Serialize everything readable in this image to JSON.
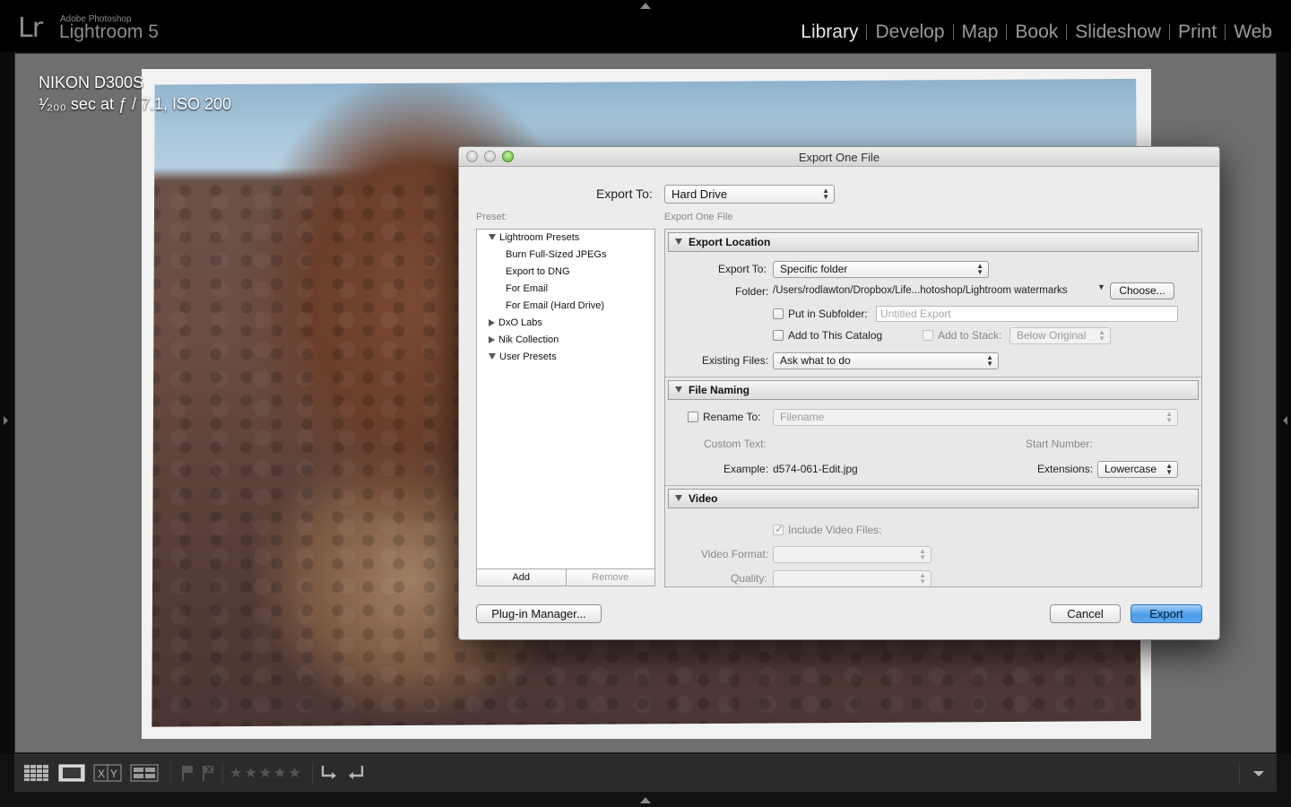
{
  "app": {
    "logo": "Lr",
    "brand_small": "Adobe Photoshop",
    "brand_big": "Lightroom 5"
  },
  "modules": [
    {
      "label": "Library",
      "active": true
    },
    {
      "label": "Develop"
    },
    {
      "label": "Map"
    },
    {
      "label": "Book"
    },
    {
      "label": "Slideshow"
    },
    {
      "label": "Print"
    },
    {
      "label": "Web"
    }
  ],
  "photo_info": {
    "camera": "NIKON D300S",
    "exposure": "¹⁄₂₀₀ sec at ƒ / 7.1, ISO 200"
  },
  "dialog": {
    "title": "Export One File",
    "export_to_label": "Export To:",
    "export_to_value": "Hard Drive",
    "preset_label": "Preset:",
    "settings_label": "Export One File",
    "presets": [
      {
        "label": "Lightroom Presets",
        "type": "folder-open"
      },
      {
        "label": "Burn Full-Sized JPEGs",
        "type": "item"
      },
      {
        "label": "Export to DNG",
        "type": "item"
      },
      {
        "label": "For Email",
        "type": "item"
      },
      {
        "label": "For Email (Hard Drive)",
        "type": "item"
      },
      {
        "label": "DxO Labs",
        "type": "folder-closed"
      },
      {
        "label": "Nik Collection",
        "type": "folder-closed"
      },
      {
        "label": "User Presets",
        "type": "folder-open"
      }
    ],
    "add_label": "Add",
    "remove_label": "Remove",
    "export_location": {
      "title": "Export Location",
      "export_to_label": "Export To:",
      "export_to_value": "Specific folder",
      "folder_label": "Folder:",
      "folder_path": "/Users/rodlawton/Dropbox/Life...hotoshop/Lightroom watermarks",
      "choose_label": "Choose...",
      "subfolder_label": "Put in Subfolder:",
      "subfolder_placeholder": "Untitled Export",
      "add_catalog_label": "Add to This Catalog",
      "add_stack_label": "Add to Stack:",
      "stack_value": "Below Original",
      "existing_files_label": "Existing Files:",
      "existing_files_value": "Ask what to do"
    },
    "file_naming": {
      "title": "File Naming",
      "rename_label": "Rename To:",
      "rename_value": "Filename",
      "custom_text_label": "Custom Text:",
      "start_number_label": "Start Number:",
      "example_label": "Example:",
      "example_value": "d574-061-Edit.jpg",
      "extensions_label": "Extensions:",
      "extensions_value": "Lowercase"
    },
    "video": {
      "title": "Video",
      "include_label": "Include Video Files:",
      "format_label": "Video Format:",
      "quality_label": "Quality:"
    },
    "plugin_manager_label": "Plug-in Manager...",
    "cancel_label": "Cancel",
    "export_label": "Export"
  },
  "toolbar": {
    "rating": "★★★★★"
  }
}
